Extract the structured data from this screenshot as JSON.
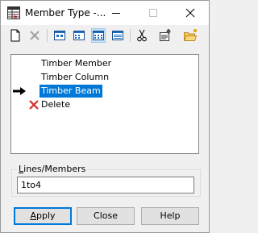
{
  "window": {
    "title": "Member Type -...",
    "controls": {
      "minimize": "minimize-icon",
      "maximize": "maximize-icon",
      "close": "close-icon"
    }
  },
  "toolbar": {
    "tools": [
      {
        "name": "new-icon"
      },
      {
        "name": "delete-cross-icon"
      },
      {
        "name": "view-large-icon"
      },
      {
        "name": "view-small-icon"
      },
      {
        "name": "view-list-icon"
      },
      {
        "name": "view-details-icon"
      },
      {
        "name": "cut-icon"
      },
      {
        "name": "properties-icon"
      },
      {
        "name": "open-folder-icon"
      }
    ]
  },
  "list": {
    "items": [
      "Timber Member",
      "Timber Column",
      "Timber Beam"
    ],
    "selected": "Timber Beam",
    "delete_label": "Delete"
  },
  "lines_members": {
    "label_underlined": "L",
    "label_rest": "ines/Members",
    "value": "1to4"
  },
  "buttons": {
    "apply_underlined": "A",
    "apply_rest": "pply",
    "close": "Close",
    "help": "Help"
  },
  "colors": {
    "selection": "#0078d7",
    "delete_x": "#d32f2f",
    "default_button_border": "#0078d7"
  }
}
